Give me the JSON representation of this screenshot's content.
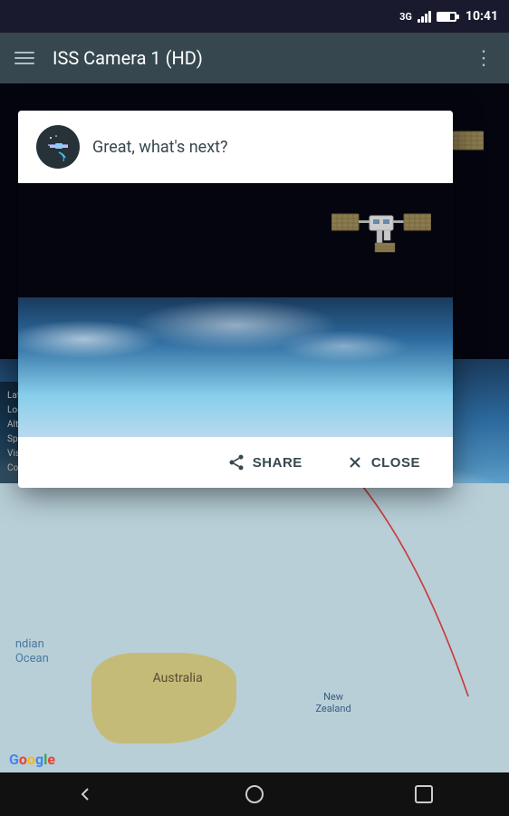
{
  "statusBar": {
    "signal": "3G",
    "time": "10:41"
  },
  "toolbar": {
    "title": "ISS Camera 1 (HD)",
    "menuIcon": "menu",
    "moreIcon": "more-vertical"
  },
  "dialog": {
    "title": "Great, what's next?",
    "iconAlt": "ISS app icon",
    "shareLabel": "SHARE",
    "closeLabel": "CLOSE",
    "imageAlt": "ISS camera view of Earth"
  },
  "map": {
    "australiaLabel": "Australia",
    "nzLine1": "New",
    "nzLine2": "Zealand",
    "oceanLabel1": "ndian",
    "oceanLabel2": "Ocean"
  },
  "telemetry": {
    "lat": "Latit",
    "lon": "Long",
    "alt": "Altit",
    "speed": "Spee",
    "visibility": "Visib",
    "country": "Coun"
  },
  "navBar": {
    "backIcon": "◁",
    "homeIcon": "○",
    "recentIcon": "□"
  }
}
